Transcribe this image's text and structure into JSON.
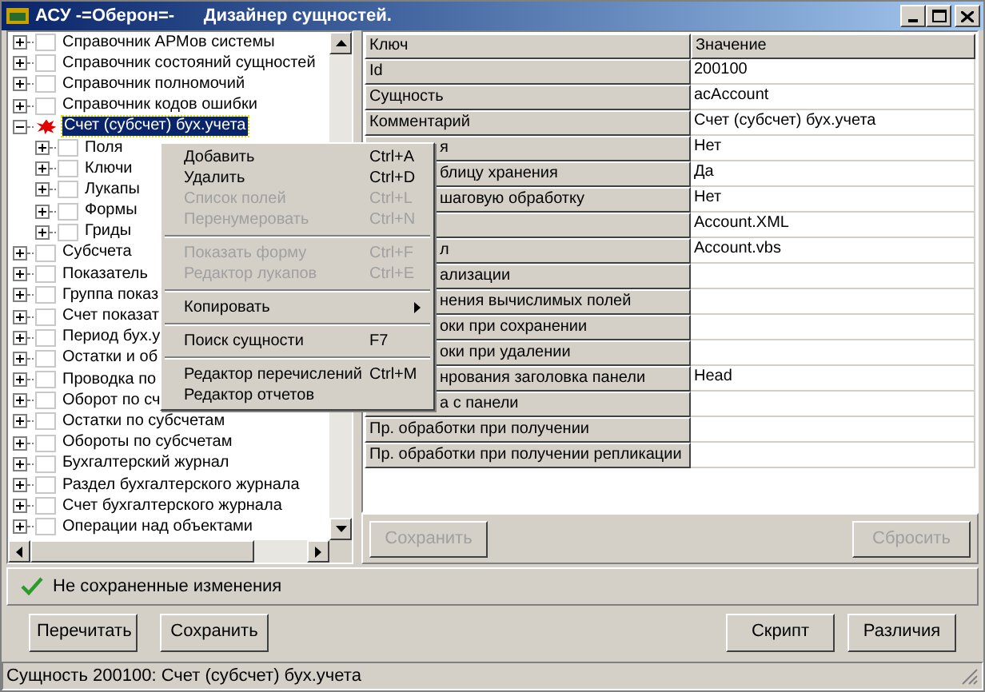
{
  "window": {
    "title": "АСУ -=Оберон=-      Дизайнер сущностей."
  },
  "tree": {
    "items": [
      {
        "label": "Справочник АРМов системы",
        "expanded": false,
        "selected": false,
        "checked": false
      },
      {
        "label": "Справочник состояний сущностей",
        "expanded": false,
        "selected": false,
        "checked": false
      },
      {
        "label": "Справочник полномочий",
        "expanded": false,
        "selected": false,
        "checked": false
      },
      {
        "label": "Справочник кодов ошибки",
        "expanded": false,
        "selected": false,
        "checked": false
      },
      {
        "label": "Счет (субсчет) бух.учета",
        "expanded": true,
        "selected": true,
        "children": [
          {
            "label": "Поля",
            "expanded": false,
            "selected": false,
            "checked": false
          },
          {
            "label": "Ключи",
            "expanded": false,
            "selected": false,
            "checked": false
          },
          {
            "label": "Лукапы",
            "expanded": false,
            "selected": false,
            "checked": false
          },
          {
            "label": "Формы",
            "expanded": false,
            "selected": false,
            "checked": false
          },
          {
            "label": "Гриды",
            "expanded": false,
            "selected": false,
            "checked": false
          }
        ]
      },
      {
        "label": "Субсчета",
        "expanded": false,
        "selected": false,
        "checked": false
      },
      {
        "label": "Показатель",
        "expanded": false,
        "selected": false,
        "checked": false
      },
      {
        "label": "Группа показ",
        "expanded": false,
        "selected": false,
        "checked": false
      },
      {
        "label": "Счет показат",
        "expanded": false,
        "selected": false,
        "checked": false
      },
      {
        "label": "Период бух.у",
        "expanded": false,
        "selected": false,
        "checked": false
      },
      {
        "label": "Остатки и об",
        "expanded": false,
        "selected": false,
        "checked": false
      },
      {
        "label": "Проводка по",
        "expanded": false,
        "selected": false,
        "checked": false
      },
      {
        "label": "Оборот по сч",
        "expanded": false,
        "selected": false,
        "checked": false
      },
      {
        "label": "Остатки по субсчетам",
        "expanded": false,
        "selected": false,
        "checked": false
      },
      {
        "label": "Обороты по субсчетам",
        "expanded": false,
        "selected": false,
        "checked": false
      },
      {
        "label": "Бухгалтерский журнал",
        "expanded": false,
        "selected": false,
        "checked": false
      },
      {
        "label": "Раздел бухгалтерского журнала",
        "expanded": false,
        "selected": false,
        "checked": false
      },
      {
        "label": "Счет бухгалтерского журнала",
        "expanded": false,
        "selected": false,
        "checked": false
      },
      {
        "label": "Операции над объектами",
        "expanded": false,
        "selected": false,
        "checked": false
      }
    ]
  },
  "properties": {
    "columns": [
      "Ключ",
      "Значение"
    ],
    "rows": [
      {
        "key": "Id",
        "value": "200100",
        "hidden": false
      },
      {
        "key": "Сущность",
        "value": "acAccount",
        "hidden": false
      },
      {
        "key": "Комментарий",
        "value": "Счет (субсчет) бух.учета",
        "hidden": false
      },
      {
        "key": "я",
        "value": "Нет",
        "hidden": true
      },
      {
        "key": "блицу хранения",
        "value": "Да",
        "hidden": true
      },
      {
        "key": "шаговую обработку",
        "value": "Нет",
        "hidden": true
      },
      {
        "key": "",
        "value": "Account.XML"
      },
      {
        "key": "л",
        "value": "Account.vbs",
        "hidden": true
      },
      {
        "key": "ализации",
        "value": "",
        "hidden": true
      },
      {
        "key": "нения вычислимых полей",
        "value": "",
        "hidden": true
      },
      {
        "key": "оки при сохранении",
        "value": "",
        "hidden": true
      },
      {
        "key": "оки при удалении",
        "value": "",
        "hidden": true
      },
      {
        "key": "нрования заголовка панели",
        "value": "Head",
        "hidden": true
      },
      {
        "key": "а с панели",
        "value": "",
        "hidden": true
      },
      {
        "key": "Пр. обработки при получении",
        "value": "",
        "hidden": false
      },
      {
        "key": "Пр. обработки при получении репликации",
        "value": "",
        "hidden": false
      }
    ],
    "buttons": [
      {
        "label": "Сохранить",
        "disabled": true
      },
      {
        "label": "Сбросить",
        "disabled": true
      }
    ]
  },
  "context_menu": {
    "items": [
      {
        "kind": "item",
        "label": "Добавить",
        "shortcut": "Ctrl+A",
        "disabled": false
      },
      {
        "kind": "item",
        "label": "Удалить",
        "shortcut": "Ctrl+D",
        "disabled": false
      },
      {
        "kind": "item",
        "label": "Список полей",
        "shortcut": "Ctrl+L",
        "disabled": true
      },
      {
        "kind": "item",
        "label": "Перенумеровать",
        "shortcut": "Ctrl+N",
        "disabled": true
      },
      {
        "kind": "separator"
      },
      {
        "kind": "item",
        "label": "Показать форму",
        "shortcut": "Ctrl+F",
        "disabled": true
      },
      {
        "kind": "item",
        "label": "Редактор лукапов",
        "shortcut": "Ctrl+E",
        "disabled": true
      },
      {
        "kind": "separator"
      },
      {
        "kind": "submenu",
        "label": "Копировать",
        "disabled": false
      },
      {
        "kind": "separator"
      },
      {
        "kind": "item",
        "label": "Поиск сущности",
        "shortcut": "F7",
        "disabled": false
      },
      {
        "kind": "separator"
      },
      {
        "kind": "item",
        "label": "Редактор перечислений",
        "shortcut": "Ctrl+M",
        "disabled": false
      },
      {
        "kind": "item",
        "label": "Редактор отчетов",
        "disabled": false
      }
    ]
  },
  "status_message": {
    "text": "Не сохраненные изменения"
  },
  "left_buttons": [
    {
      "label": "Перечитать"
    },
    {
      "label": "Сохранить"
    }
  ],
  "right_buttons": [
    {
      "label": "Скрипт"
    },
    {
      "label": "Различия"
    }
  ],
  "status_bar": {
    "text": "Сущность 200100: Счет (субсчет) бух.учета"
  }
}
